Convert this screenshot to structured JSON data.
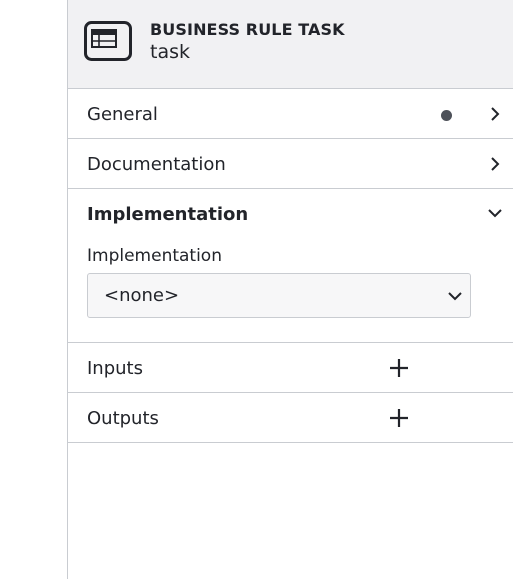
{
  "header": {
    "type_label": "BUSINESS RULE TASK",
    "element_name": "task",
    "icon": "business-rule-task-icon"
  },
  "groups": {
    "general": {
      "label": "General",
      "has_entries_indicator": true,
      "expanded": false
    },
    "documentation": {
      "label": "Documentation",
      "expanded": false
    },
    "implementation": {
      "label": "Implementation",
      "expanded": true,
      "field_label": "Implementation",
      "selected_value": "<none>"
    },
    "inputs": {
      "label": "Inputs",
      "action": "add"
    },
    "outputs": {
      "label": "Outputs",
      "action": "add"
    }
  },
  "colors": {
    "header_bg": "#f1f1f3",
    "divider": "#c9ccd1",
    "text": "#22242a",
    "indicator": "#4d5159"
  }
}
